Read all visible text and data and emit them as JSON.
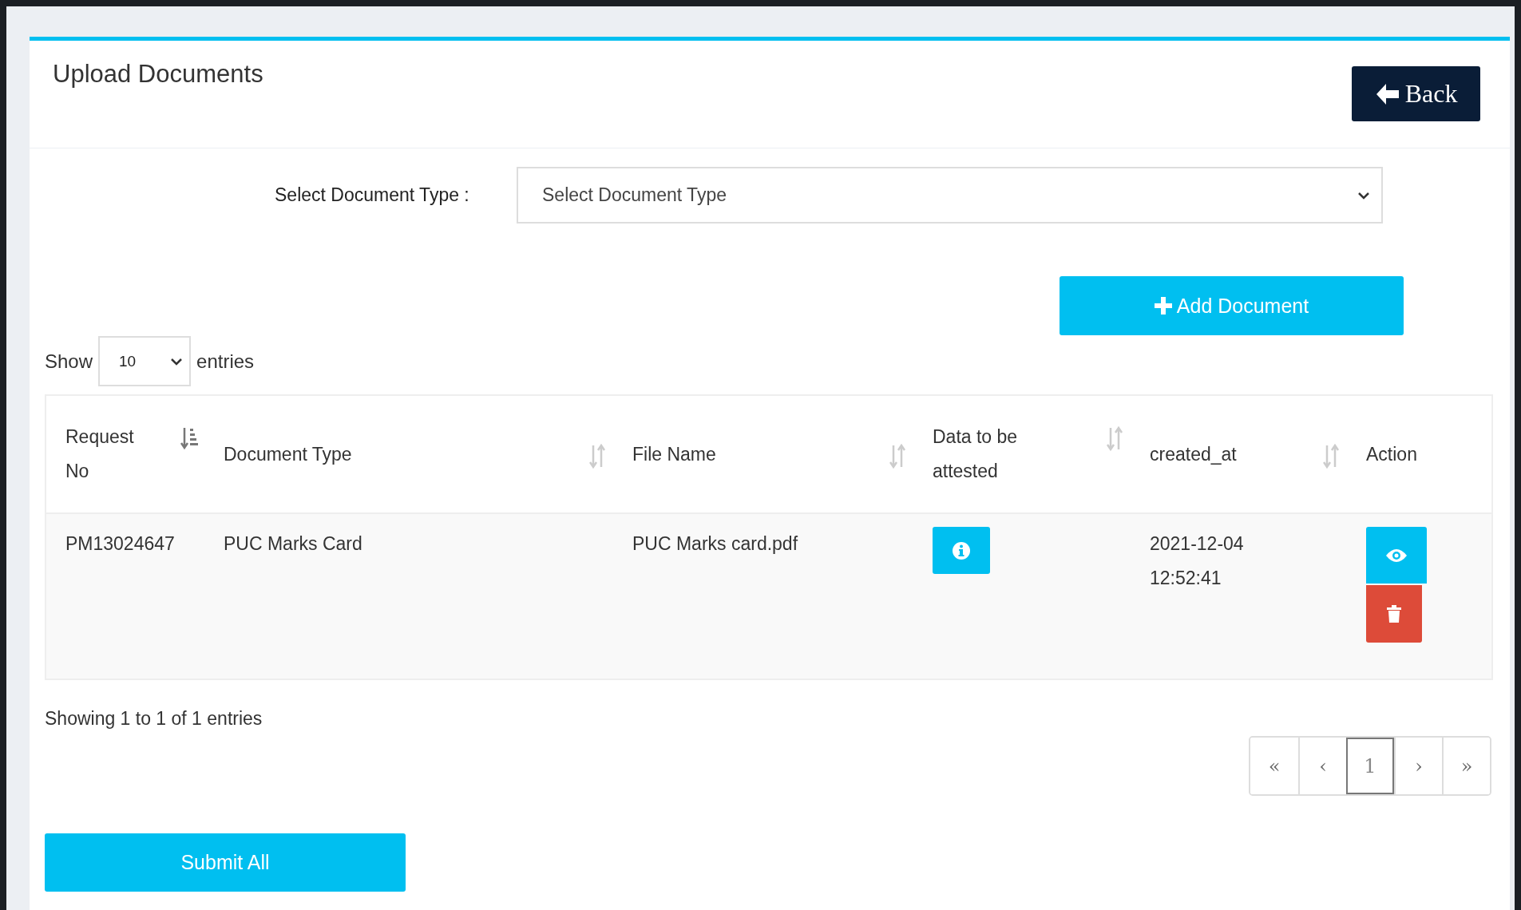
{
  "page": {
    "title": "Upload Documents",
    "back_button": "Back"
  },
  "form": {
    "label": "Select Document Type :",
    "placeholder": "Select Document Type",
    "add_button": "Add Document"
  },
  "length_menu": {
    "before": "Show",
    "value": "10",
    "after": "entries"
  },
  "table": {
    "columns": [
      {
        "label": "Request No",
        "kind": "sorted"
      },
      {
        "label": "Document Type",
        "kind": "sortable"
      },
      {
        "label": "File Name",
        "kind": "sortable"
      },
      {
        "label": "Data to be attested",
        "kind": "sortable"
      },
      {
        "label": "created_at",
        "kind": "sortable"
      },
      {
        "label": "Action",
        "kind": "plain"
      }
    ],
    "rows": [
      {
        "cells": [
          {
            "kind": "text",
            "text": "PM13024647"
          },
          {
            "kind": "text",
            "text": "PUC Marks Card"
          },
          {
            "kind": "text",
            "text": "PUC Marks card.pdf"
          },
          {
            "kind": "info"
          },
          {
            "kind": "text",
            "text": "2021-12-04 12:52:41"
          },
          {
            "kind": "actions"
          }
        ]
      }
    ]
  },
  "info": "Showing 1 to 1 of 1 entries",
  "pagination": [
    {
      "label": "«",
      "selected": false
    },
    {
      "label": "‹",
      "selected": false
    },
    {
      "label": "1",
      "selected": true
    },
    {
      "label": "›",
      "selected": false
    },
    {
      "label": "»",
      "selected": false
    }
  ],
  "submit_button": "Submit All"
}
